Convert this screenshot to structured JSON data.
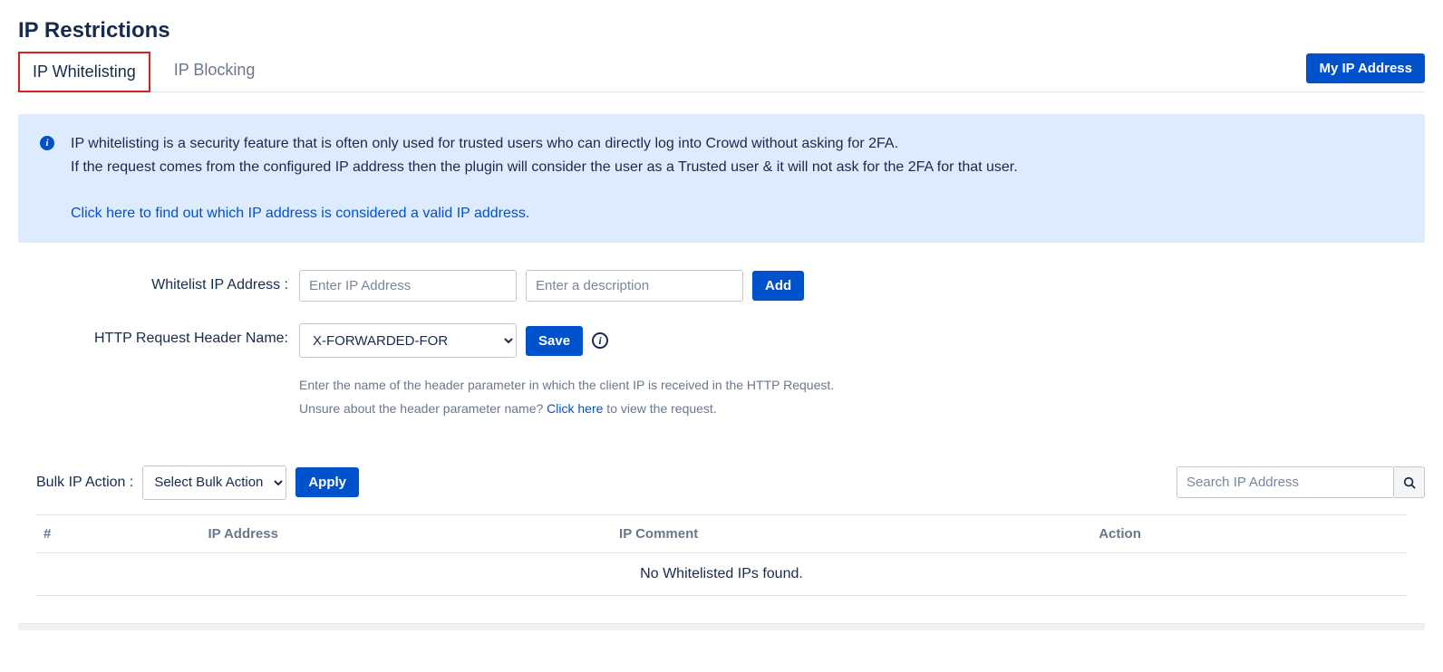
{
  "page": {
    "title": "IP Restrictions"
  },
  "tabs": {
    "whitelisting": "IP Whitelisting",
    "blocking": "IP Blocking"
  },
  "buttons": {
    "my_ip": "My IP Address",
    "add": "Add",
    "save": "Save",
    "apply": "Apply"
  },
  "info": {
    "line1": "IP whitelisting is a security feature that is often only used for trusted users who can directly log into Crowd without asking for 2FA.",
    "line2": "If the request comes from the configured IP address then the plugin will consider the user as a Trusted user & it will not ask for the 2FA for that user.",
    "link": "Click here to find out which IP address is considered a valid IP address."
  },
  "form": {
    "whitelist_label": "Whitelist IP Address :",
    "ip_placeholder": "Enter IP Address",
    "desc_placeholder": "Enter a description",
    "header_label": "HTTP Request Header Name:",
    "header_selected": "X-FORWARDED-FOR",
    "help1": "Enter the name of the header parameter in which the client IP is received in the HTTP Request.",
    "help2_pre": "Unsure about the header parameter name? ",
    "help2_link": "Click here",
    "help2_post": " to view the request."
  },
  "bulk": {
    "label": "Bulk IP Action :",
    "selected": "Select Bulk Action",
    "search_placeholder": "Search IP Address"
  },
  "table": {
    "col_hash": "#",
    "col_ip": "IP Address",
    "col_comment": "IP Comment",
    "col_action": "Action",
    "empty": "No Whitelisted IPs found."
  }
}
